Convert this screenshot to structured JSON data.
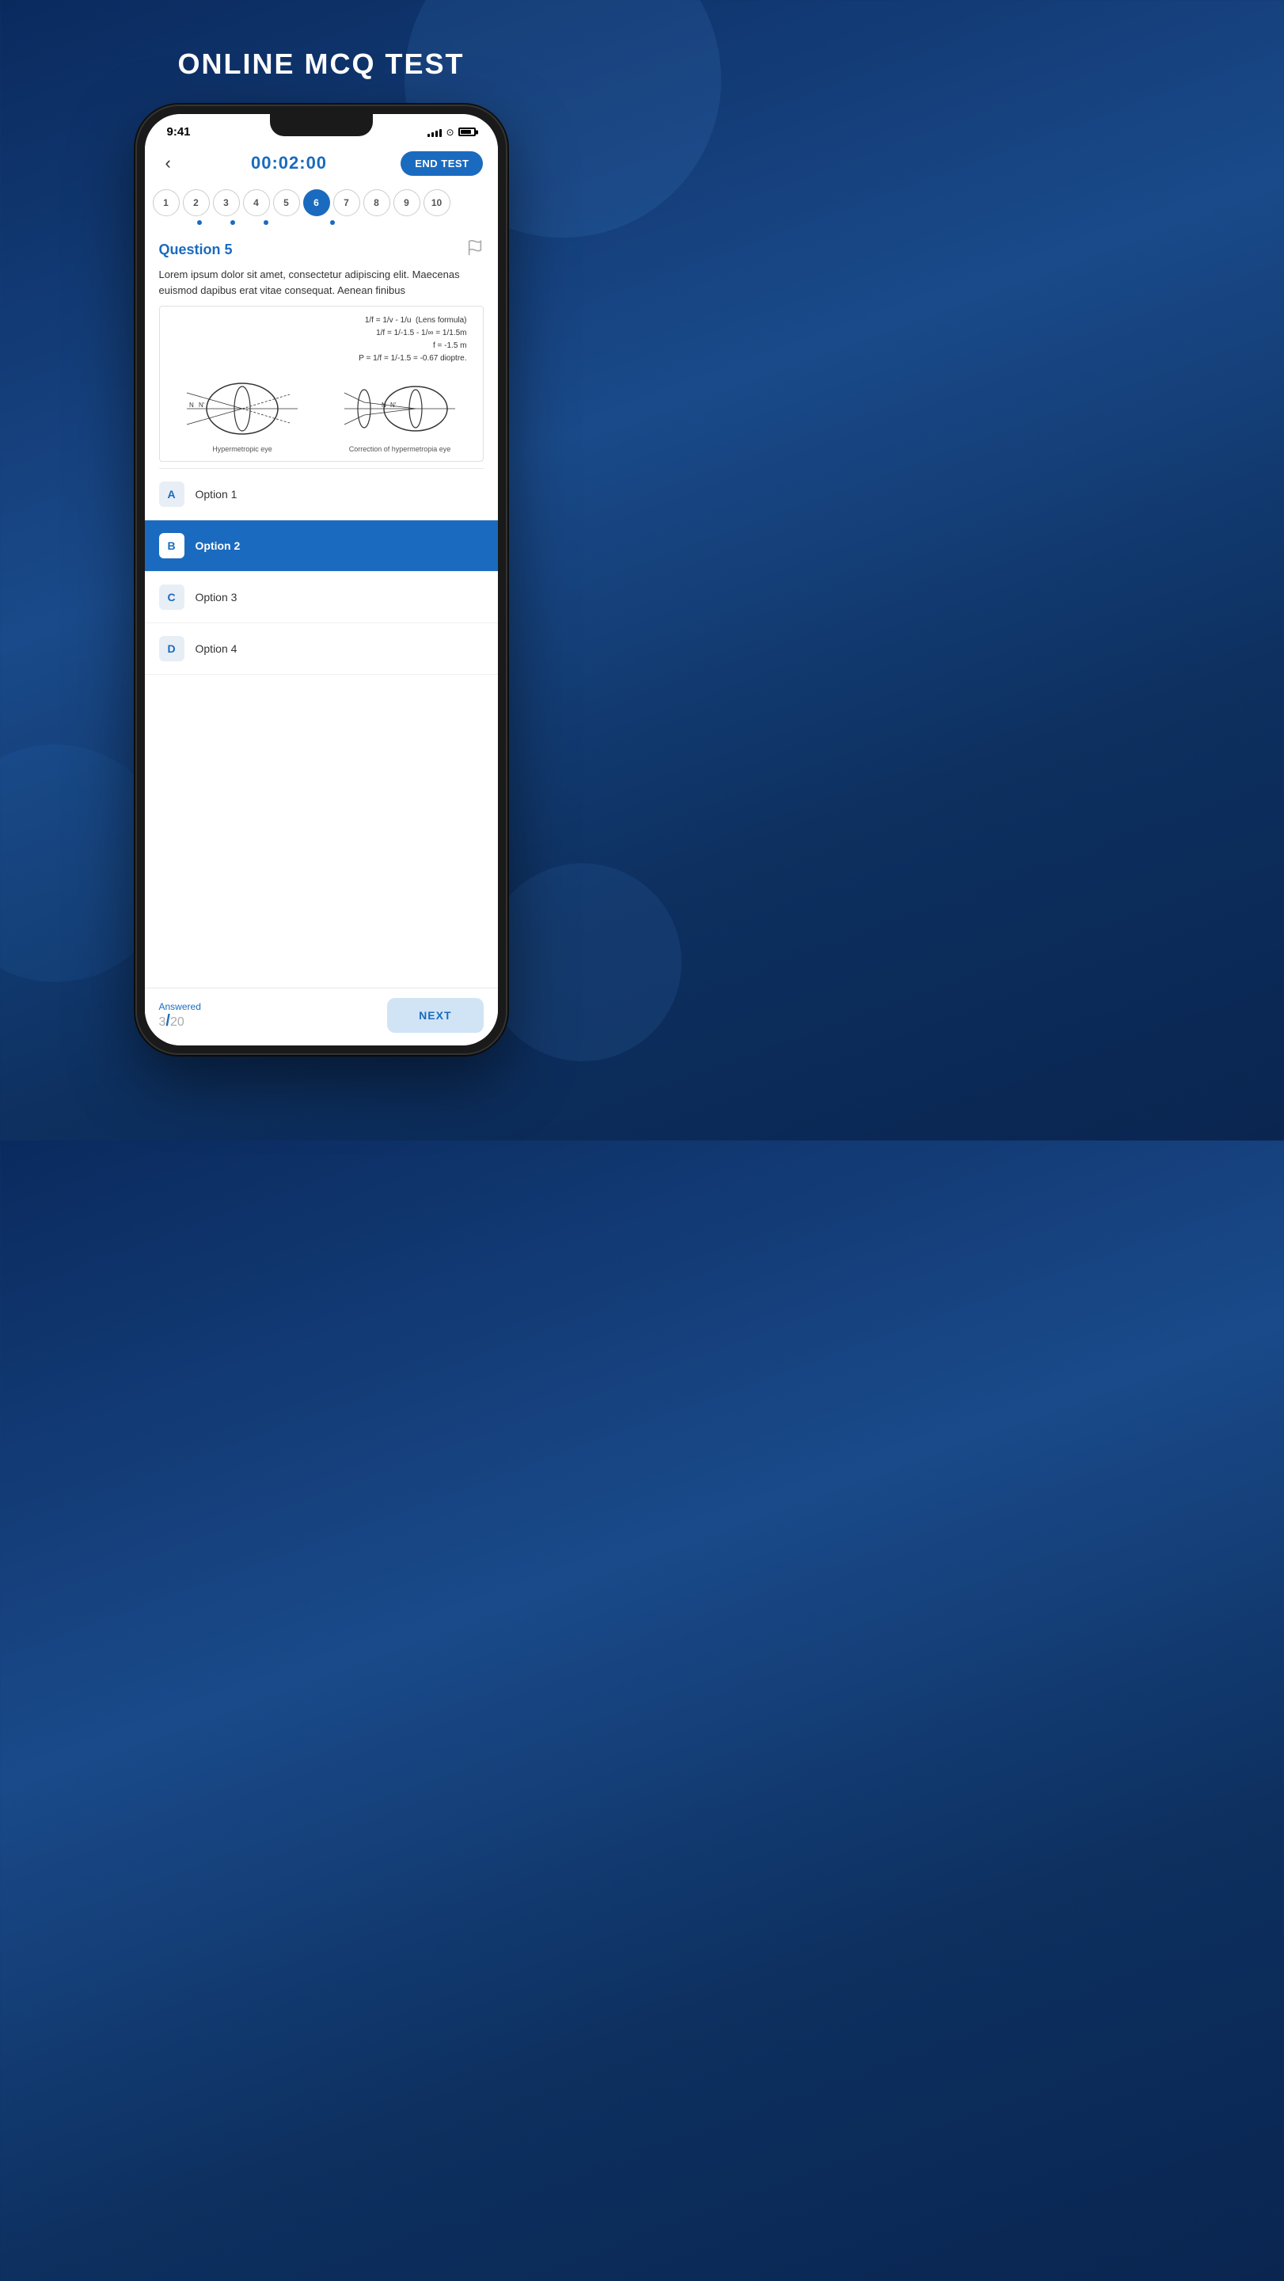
{
  "page": {
    "title": "ONLINE MCQ TEST"
  },
  "status_bar": {
    "time": "9:41"
  },
  "header": {
    "timer": "00:02:00",
    "end_test_label": "END TEST",
    "back_icon": "‹"
  },
  "question_numbers": [
    1,
    2,
    3,
    4,
    5,
    6,
    7,
    8,
    9,
    10
  ],
  "active_question_index": 5,
  "dot_positions": [
    1,
    2,
    3,
    5
  ],
  "question": {
    "title": "Question 5",
    "text": "Lorem ipsum dolor sit amet, consectetur adipiscing elit. Maecenas euismod dapibus erat vitae consequat. Aenean finibus",
    "has_diagram": true,
    "diagram_label_1": "Hypermetropic eye",
    "diagram_label_2": "Correction of hypermetropia eye",
    "lens_formula_lines": [
      "1/f = 1/v - 1/u  (Lens formula)",
      "1/f = 1/-1.5 - 1/∞ = 1/1.5m",
      "f = -1.5 m",
      "P = 1/f = 1/-1.5 = -0.67 dioptre."
    ]
  },
  "options": [
    {
      "letter": "A",
      "text": "Option 1",
      "selected": false
    },
    {
      "letter": "B",
      "text": "Option 2",
      "selected": true
    },
    {
      "letter": "C",
      "text": "Option 3",
      "selected": false
    },
    {
      "letter": "D",
      "text": "Option 4",
      "selected": false
    }
  ],
  "footer": {
    "answered_label": "Answered",
    "answered_count": "3",
    "total": "20",
    "next_label": "NEXT"
  }
}
